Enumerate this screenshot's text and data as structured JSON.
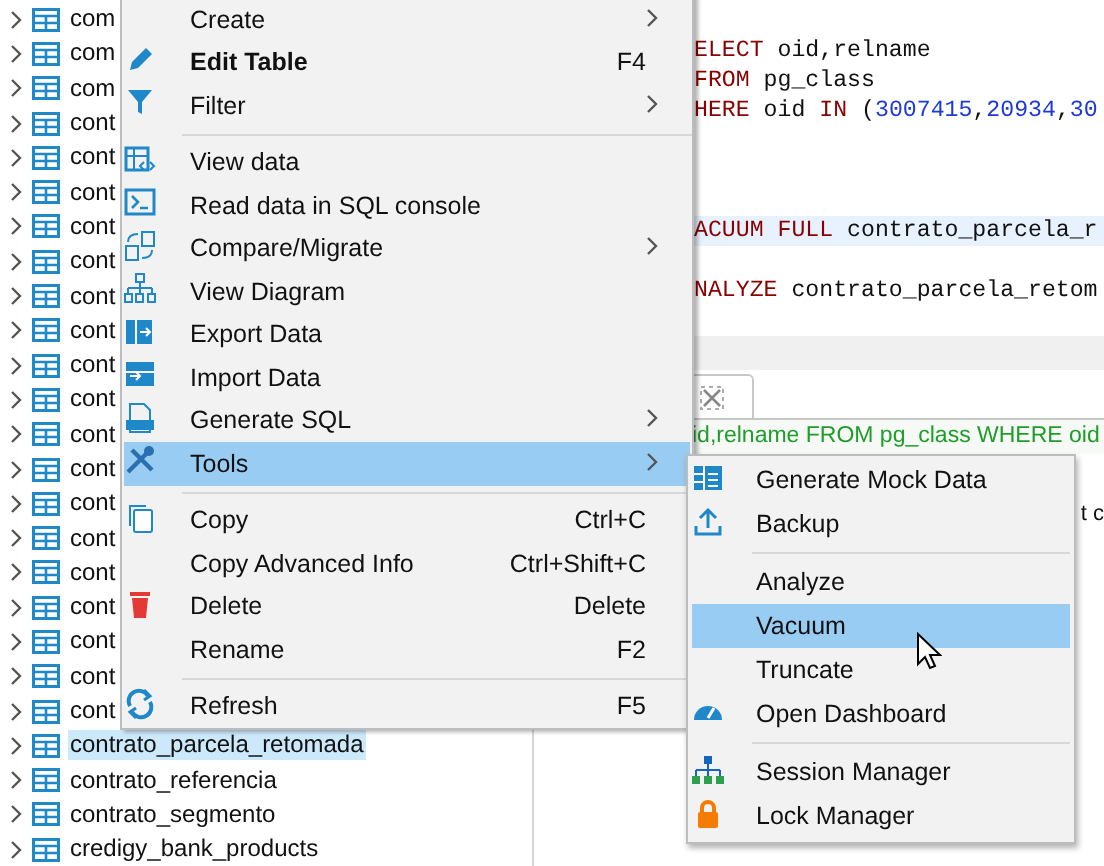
{
  "tree": {
    "items": [
      {
        "name": "com",
        "selected": false
      },
      {
        "name": "com",
        "selected": false
      },
      {
        "name": "com",
        "selected": false
      },
      {
        "name": "cont",
        "selected": false
      },
      {
        "name": "cont",
        "selected": false
      },
      {
        "name": "cont",
        "selected": false
      },
      {
        "name": "cont",
        "selected": false
      },
      {
        "name": "cont",
        "selected": false
      },
      {
        "name": "cont",
        "selected": false
      },
      {
        "name": "cont",
        "selected": false
      },
      {
        "name": "cont",
        "selected": false
      },
      {
        "name": "cont",
        "selected": false
      },
      {
        "name": "cont",
        "selected": false
      },
      {
        "name": "cont",
        "selected": false
      },
      {
        "name": "cont",
        "selected": false
      },
      {
        "name": "cont",
        "selected": false
      },
      {
        "name": "cont",
        "selected": false
      },
      {
        "name": "cont",
        "selected": false
      },
      {
        "name": "cont",
        "selected": false
      },
      {
        "name": "cont",
        "selected": false
      },
      {
        "name": "cont",
        "selected": false
      },
      {
        "name": "contrato_parcela_retomada",
        "selected": true
      },
      {
        "name": "contrato_referencia",
        "selected": false
      },
      {
        "name": "contrato_segmento",
        "selected": false
      },
      {
        "name": "credigy_bank_products",
        "selected": false
      }
    ]
  },
  "editor": {
    "lines": [
      {
        "kind": "code",
        "highlighted": false,
        "tokens": [
          {
            "text": "ELECT",
            "kind": "keyword"
          },
          {
            "text": " oid,relname",
            "kind": "plain"
          }
        ]
      },
      {
        "kind": "code",
        "highlighted": false,
        "tokens": [
          {
            "text": "FROM",
            "kind": "keyword"
          },
          {
            "text": " pg_class",
            "kind": "plain"
          }
        ]
      },
      {
        "kind": "code",
        "highlighted": false,
        "tokens": [
          {
            "text": "HERE",
            "kind": "keyword"
          },
          {
            "text": " oid ",
            "kind": "plain"
          },
          {
            "text": "IN",
            "kind": "keyword"
          },
          {
            "text": " (",
            "kind": "plain"
          },
          {
            "text": "3007415",
            "kind": "number"
          },
          {
            "text": ",",
            "kind": "plain"
          },
          {
            "text": "20934",
            "kind": "number"
          },
          {
            "text": ",",
            "kind": "plain"
          },
          {
            "text": "30",
            "kind": "number"
          }
        ]
      },
      {
        "kind": "blank"
      },
      {
        "kind": "blank"
      },
      {
        "kind": "blank"
      },
      {
        "kind": "code",
        "highlighted": true,
        "tokens": [
          {
            "text": "ACUUM FULL",
            "kind": "keyword"
          },
          {
            "text": " contrato_parcela_r",
            "kind": "plain"
          }
        ]
      },
      {
        "kind": "blank"
      },
      {
        "kind": "code",
        "highlighted": false,
        "tokens": [
          {
            "text": "NALYZE",
            "kind": "keyword"
          },
          {
            "text": " contrato_parcela_retom",
            "kind": "plain"
          }
        ]
      }
    ]
  },
  "results": {
    "query_text": "id,relname FROM pg_class WHERE oid",
    "output_text": "t c"
  },
  "context_menu": {
    "items": [
      {
        "kind": "item",
        "label": "Create",
        "has_submenu": true,
        "selected": false
      },
      {
        "kind": "item",
        "label": "Edit Table",
        "bold": true,
        "shortcut": "F4",
        "selected": false
      },
      {
        "kind": "item",
        "label": "Filter",
        "has_submenu": true,
        "selected": false
      },
      {
        "kind": "separator"
      },
      {
        "kind": "item",
        "label": "View data",
        "selected": false
      },
      {
        "kind": "item",
        "label": "Read data in SQL console",
        "selected": false
      },
      {
        "kind": "item",
        "label": "Compare/Migrate",
        "has_submenu": true,
        "selected": false
      },
      {
        "kind": "item",
        "label": "View Diagram",
        "selected": false
      },
      {
        "kind": "item",
        "label": "Export Data",
        "selected": false
      },
      {
        "kind": "item",
        "label": "Import Data",
        "selected": false
      },
      {
        "kind": "item",
        "label": "Generate SQL",
        "has_submenu": true,
        "selected": false
      },
      {
        "kind": "item",
        "label": "Tools",
        "has_submenu": true,
        "selected": true
      },
      {
        "kind": "separator"
      },
      {
        "kind": "item",
        "label": "Copy",
        "shortcut": "Ctrl+C",
        "selected": false
      },
      {
        "kind": "item",
        "label": "Copy Advanced Info",
        "shortcut": "Ctrl+Shift+C",
        "selected": false
      },
      {
        "kind": "item",
        "label": "Delete",
        "shortcut": "Delete",
        "selected": false
      },
      {
        "kind": "item",
        "label": "Rename",
        "shortcut": "F2",
        "selected": false
      },
      {
        "kind": "separator"
      },
      {
        "kind": "item",
        "label": "Refresh",
        "shortcut": "F5",
        "selected": false
      }
    ]
  },
  "tools_submenu": {
    "items": [
      {
        "kind": "item",
        "label": "Generate Mock Data",
        "selected": false
      },
      {
        "kind": "item",
        "label": "Backup",
        "selected": false
      },
      {
        "kind": "separator"
      },
      {
        "kind": "item",
        "label": "Analyze",
        "selected": false
      },
      {
        "kind": "item",
        "label": "Vacuum",
        "selected": true
      },
      {
        "kind": "item",
        "label": "Truncate",
        "selected": false
      },
      {
        "kind": "item",
        "label": "Open Dashboard",
        "selected": false
      },
      {
        "kind": "separator"
      },
      {
        "kind": "item",
        "label": "Session Manager",
        "selected": false
      },
      {
        "kind": "item",
        "label": "Lock Manager",
        "selected": false
      }
    ]
  }
}
